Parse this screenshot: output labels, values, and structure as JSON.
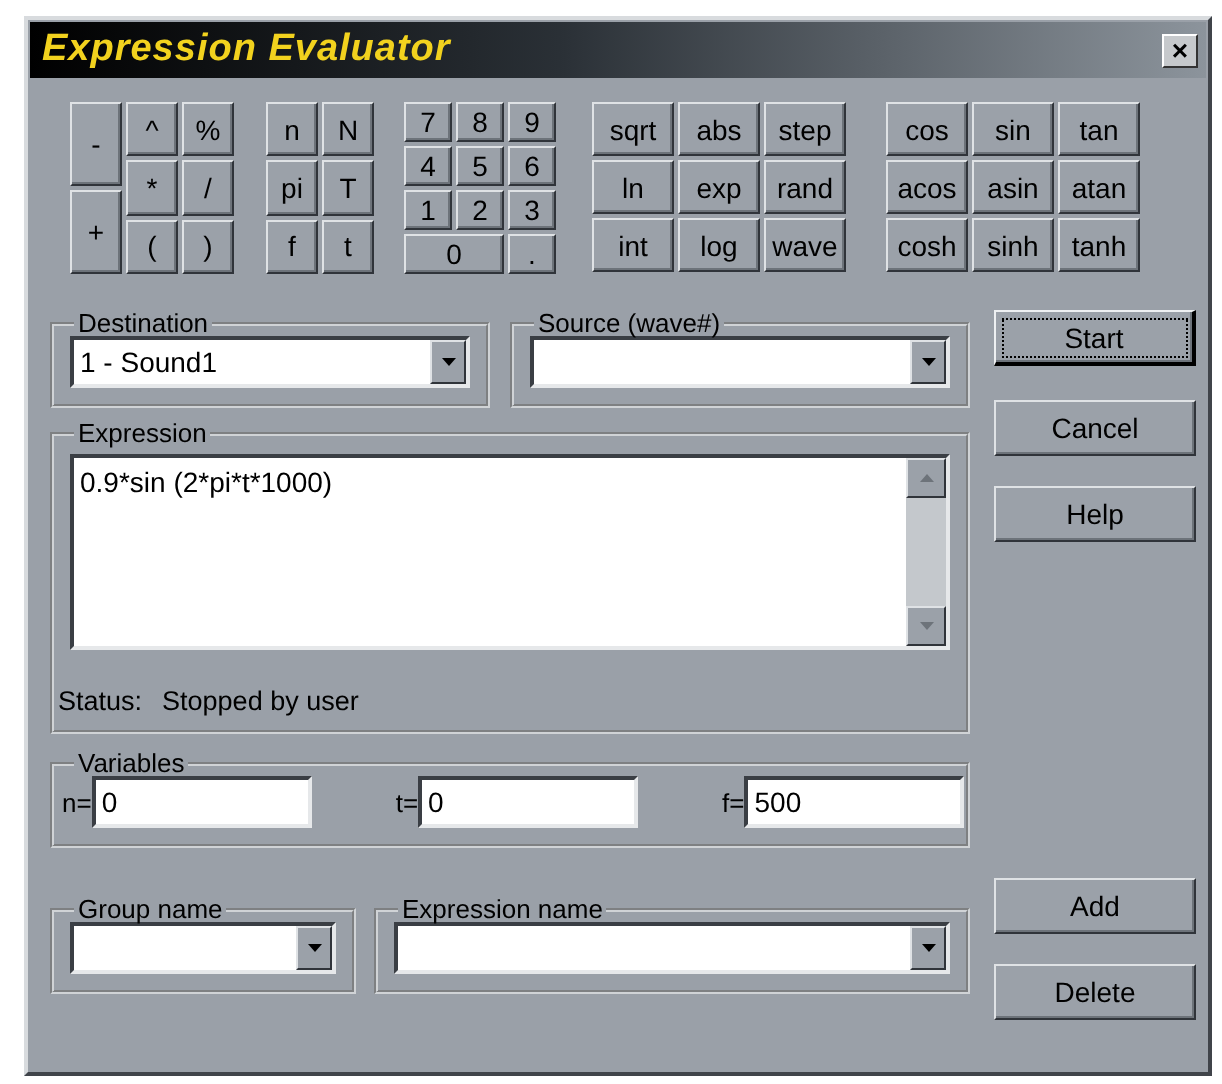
{
  "window": {
    "title": "Expression Evaluator",
    "close": "×"
  },
  "keypad": [
    {
      "kind": "columns",
      "lines": [
        [
          "-",
          "+"
        ],
        [
          "^",
          "*",
          "("
        ],
        [
          "%",
          "/",
          ")"
        ]
      ]
    },
    {
      "kind": "columns",
      "lines": [
        [
          "n",
          "pi",
          "f"
        ],
        [
          "N",
          "T",
          "t"
        ]
      ]
    },
    {
      "kind": "rows",
      "lines": [
        [
          "7",
          "8",
          "9"
        ],
        [
          "4",
          "5",
          "6"
        ],
        [
          "1",
          "2",
          "3"
        ],
        [
          "0",
          "."
        ]
      ]
    },
    {
      "kind": "rows",
      "lines": [
        [
          "sqrt",
          "abs",
          "step"
        ],
        [
          "ln",
          "exp",
          "rand"
        ],
        [
          "int",
          "log",
          "wave"
        ]
      ]
    },
    {
      "kind": "rows",
      "lines": [
        [
          "cos",
          "sin",
          "tan"
        ],
        [
          "acos",
          "asin",
          "atan"
        ],
        [
          "cosh",
          "sinh",
          "tanh"
        ]
      ]
    }
  ],
  "destination": {
    "label": "Destination",
    "value": "1 - Sound1"
  },
  "source": {
    "label": "Source (wave#)"
  },
  "expression": {
    "label": "Expression",
    "value": "0.9*sin (2*pi*t*1000)",
    "status_label": "Status:",
    "status": "Stopped by user"
  },
  "variables": {
    "label": "Variables",
    "fields": [
      {
        "label": "n=",
        "value": "0"
      },
      {
        "label": "t=",
        "value": "0"
      },
      {
        "label": "f=",
        "value": "500"
      }
    ]
  },
  "group_name": {
    "label": "Group name"
  },
  "expression_name": {
    "label": "Expression name"
  },
  "side_buttons": [
    {
      "label": "Start",
      "focused": true
    },
    {
      "label": "Cancel",
      "focused": false
    },
    {
      "label": "Help",
      "focused": false
    }
  ],
  "bottom_buttons": [
    {
      "label": "Add",
      "focused": false
    },
    {
      "label": "Delete",
      "focused": false
    }
  ]
}
